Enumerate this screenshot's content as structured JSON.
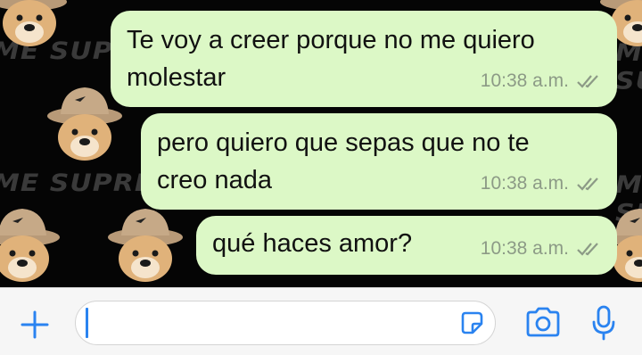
{
  "wallpaper": {
    "brand_text": "ME SUPREME"
  },
  "messages": [
    {
      "text_line1": "Te voy a creer porque no me quiero",
      "text_line2": "molestar",
      "time": "10:38 a.m."
    },
    {
      "text_line1": "pero quiero que sepas que no te",
      "text_line2": "creo nada",
      "time": "10:38 a.m."
    },
    {
      "text_line1": "qué haces amor?",
      "time": "10:38 a.m."
    }
  ],
  "input": {
    "placeholder": ""
  },
  "icons": {
    "attach": "plus-icon",
    "sticker": "sticker-icon",
    "camera": "camera-icon",
    "mic": "microphone-icon",
    "read_receipt": "double-check-icon"
  },
  "colors": {
    "bubble": "#dcf8c6",
    "accent": "#2a83f0",
    "ticks": "#8c9a86"
  }
}
